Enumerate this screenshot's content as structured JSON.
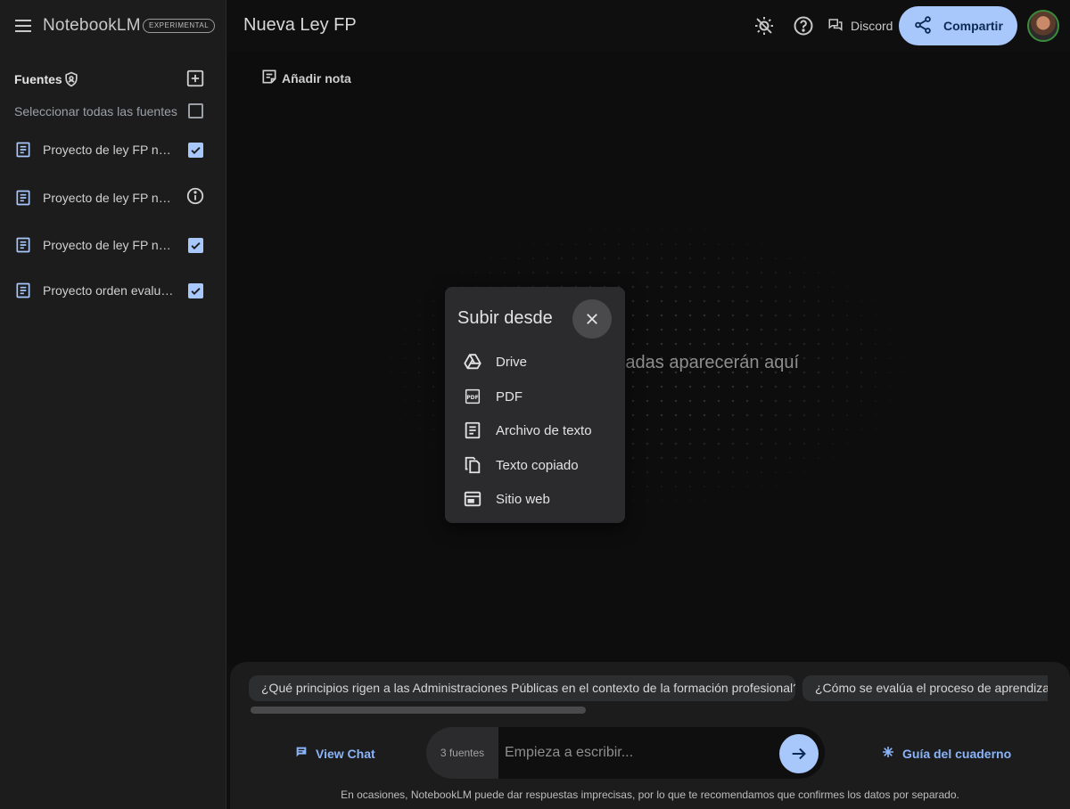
{
  "app": {
    "logo": "NotebookLM",
    "badge": "EXPERIMENTAL"
  },
  "notebook": {
    "title": "Nueva Ley FP"
  },
  "header": {
    "discord_label": "Discord",
    "share_label": "Compartir"
  },
  "sidebar": {
    "title": "Fuentes",
    "select_all_label": "Seleccionar todas las fuentes",
    "sources": [
      {
        "label": "Proyecto de ley FP nueva",
        "status": "checked"
      },
      {
        "label": "Proyecto de ley FP nueva",
        "status": "info"
      },
      {
        "label": "Proyecto de ley FP nueva",
        "status": "checked"
      },
      {
        "label": "Proyecto orden evaluación",
        "status": "checked"
      }
    ]
  },
  "main": {
    "add_note_label": "Añadir nota",
    "empty_text": "adas aparecerán aquí"
  },
  "dialog": {
    "title": "Subir desde",
    "options": [
      {
        "label": "Drive",
        "icon": "drive-icon"
      },
      {
        "label": "PDF",
        "icon": "pdf-icon"
      },
      {
        "label": "Archivo de texto",
        "icon": "text-file-icon"
      },
      {
        "label": "Texto copiado",
        "icon": "copy-icon"
      },
      {
        "label": "Sitio web",
        "icon": "web-icon"
      }
    ]
  },
  "suggestions": [
    "¿Qué principios rigen a las Administraciones Públicas en el contexto de la formación profesional?",
    "¿Cómo se evalúa el proceso de aprendizaje"
  ],
  "bottom": {
    "view_chat_label": "View Chat",
    "source_count": "3 fuentes",
    "input_placeholder": "Empieza a escribir...",
    "guide_label": "Guía del cuaderno",
    "disclaimer": "En ocasiones, NotebookLM puede dar respuestas imprecisas, por lo que te recomendamos que confirmes los datos por separado."
  },
  "colors": {
    "accent": "#a8c7fa",
    "link": "#8ab4f8",
    "background": "#0f0f10",
    "panel": "#1c1c1d"
  }
}
